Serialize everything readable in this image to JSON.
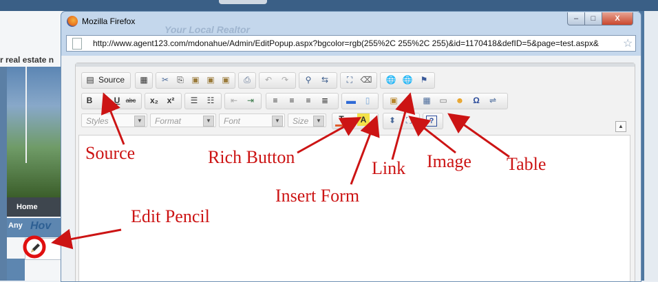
{
  "background_page": {
    "tagline": "r real estate n",
    "nav_home": "Home",
    "any_label": "Any",
    "how_title": "Hov"
  },
  "window": {
    "title": "Mozilla Firefox",
    "ghost_text": "Your Local Realtor",
    "controls": {
      "minimize": "–",
      "maximize": "□",
      "close": "X"
    },
    "url": "http://www.agent123.com/mdonahue/Admin/EditPopup.aspx?bgcolor=rgb(255%2C 255%2C 255)&id=1170418&defID=5&page=test.aspx&"
  },
  "editor": {
    "source_label": "Source",
    "row1_icons": [
      "preview-icon",
      "cut-icon",
      "copy-icon",
      "paste-icon",
      "paste-text-icon",
      "paste-word-icon",
      "print-icon",
      "undo-icon",
      "redo-icon",
      "find-icon",
      "replace-icon",
      "select-all-icon",
      "remove-format-icon",
      "link-icon",
      "unlink-icon",
      "anchor-icon"
    ],
    "row2_glyphs": {
      "bold": "B",
      "italic": "I",
      "underline": "U",
      "strike": "abc",
      "subscript": "x₂",
      "superscript": "x²"
    },
    "combos": {
      "styles": "Styles",
      "format": "Format",
      "font": "Font",
      "size": "Size"
    },
    "help": "?"
  },
  "annotations": {
    "source": "Source",
    "rich_button": "Rich Button",
    "insert_form": "Insert Form",
    "link": "Link",
    "image": "Image",
    "table": "Table",
    "edit_pencil": "Edit Pencil"
  },
  "colors": {
    "annotation": "#cc1414",
    "window_frame": "#c4d7ec"
  }
}
